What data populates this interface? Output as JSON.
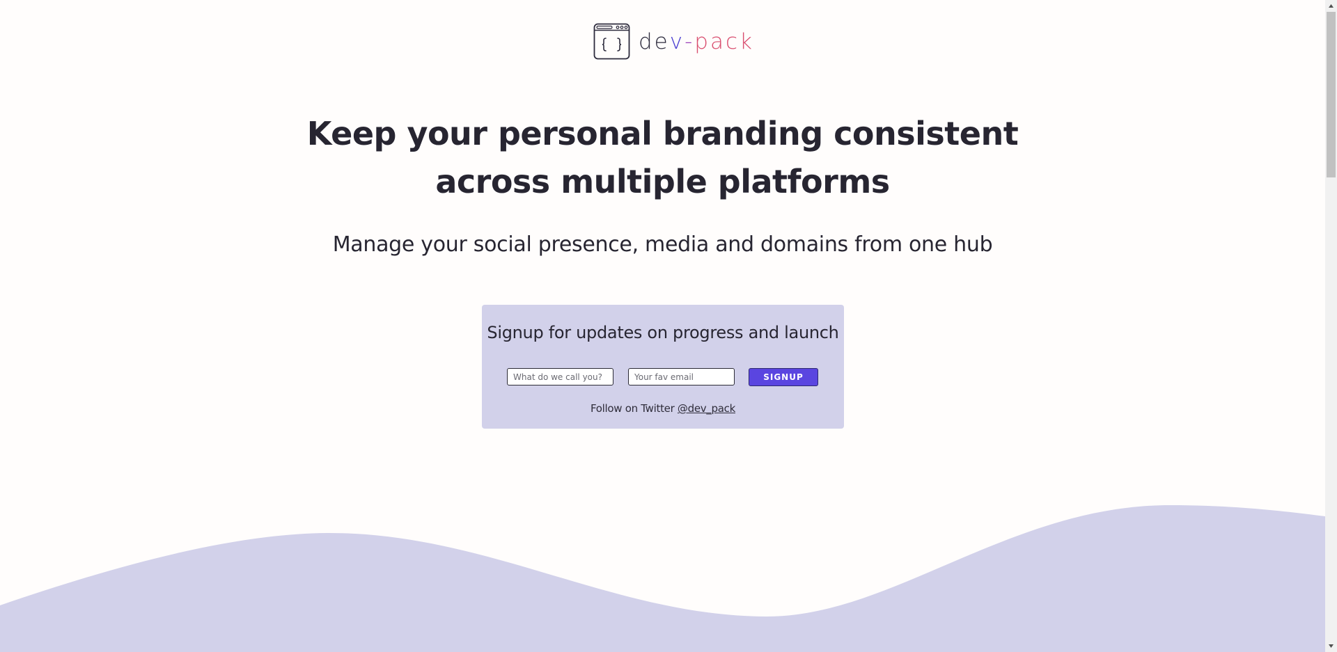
{
  "brand": {
    "part_de": "de",
    "part_v": "v",
    "part_dash": "-",
    "part_pack": "pack",
    "logo_icon": "browser-code-icon"
  },
  "hero": {
    "headline_line1": "Keep your personal branding consistent",
    "headline_line2": "across multiple platforms",
    "subheadline": "Manage your social presence, media and domains from one hub"
  },
  "signup": {
    "title": "Signup for updates on progress and launch",
    "name_placeholder": "What do we call you?",
    "name_value": "",
    "email_placeholder": "Your fav email",
    "email_value": "",
    "button_label": "SIGNUP",
    "follow_text": "Follow on Twitter ",
    "twitter_handle": "@dev_pack"
  },
  "colors": {
    "background": "#fffdfc",
    "card": "#d2d1ea",
    "wave": "#d2d1ea",
    "button": "#5a45e0",
    "brand_blue": "#4b3fd1",
    "brand_purple": "#9b3fb9",
    "brand_pink": "#d94d6e",
    "text": "#272531"
  }
}
